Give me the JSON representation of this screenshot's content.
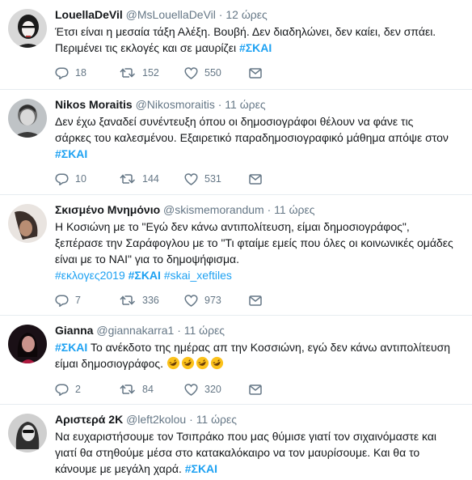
{
  "tweets": [
    {
      "name": "LouellaDeVil",
      "handle": "@MsLouellaDeVil",
      "sep": "·",
      "time": "12 ώρες",
      "line1": "Έτσι είναι η μεσαία τάξη Αλέξη. Βουβή. Δεν διαδηλώνει, δεν καίει, δεν σπάει.",
      "line2_text": "Περιμένει τις εκλογές και σε μαυρίζει ",
      "line2_tag": "#ΣΚΑΙ",
      "replies": "18",
      "retweets": "152",
      "likes": "550"
    },
    {
      "name": "Nikos Moraitis",
      "handle": "@Nikosmoraitis",
      "sep": "·",
      "time": "11 ώρες",
      "line1": "Δεν έχω ξαναδεί συνέντευξη όπου οι δημοσιογράφοι θέλουν να φάνε τις",
      "line2": "σάρκες του καλεσμένου. Εξαιρετικό παραδημοσιογραφικό μάθημα απόψε στον",
      "line3_tag": "#ΣΚΑΙ",
      "replies": "10",
      "retweets": "144",
      "likes": "531"
    },
    {
      "name": "Σκισμένο Μνημόνιο",
      "handle": "@skismemorandum",
      "sep": "·",
      "time": "11 ώρες",
      "line1": "Η Κοσιώνη με το \"Εγώ δεν κάνω αντιπολίτευση, είμαι δημοσιογράφος\",",
      "line2": "ξεπέρασε την Σαράφογλου με το \"Τι φταίμε εμείς που όλες οι κοινωνικές ομάδες",
      "line3": "είναι με το ΝΑΙ\" για το δημοψήφισμα.",
      "tag1": "#εκλογες2019",
      "tag2": "#ΣΚΑΙ",
      "tag3": "#skai_xeftiles",
      "replies": "7",
      "retweets": "336",
      "likes": "973"
    },
    {
      "name": "Gianna",
      "handle": "@giannakarra1",
      "sep": "·",
      "time": "11 ώρες",
      "line1_tag": "#ΣΚΑΙ",
      "line1_text": " Το ανέκδοτο της ημέρας απ την Κοσσιώνη, εγώ δεν κάνω αντιπολίτευση",
      "line2_text": "είμαι δημοσιογράφος. ",
      "emoji": "🤣🤣🤣🤣",
      "replies": "2",
      "retweets": "84",
      "likes": "320"
    },
    {
      "name": "Αριστερά 2Κ",
      "handle": "@left2kolou",
      "sep": "·",
      "time": "11 ώρες",
      "line1": "Να ευχαριστήσουμε τον Τσιπράκο που μας θύμισε γιατί τον σιχαινόμαστε και",
      "line2": "γιατί θα στηθούμε μέσα στο κατακαλόκαιρο να τον μαυρίσουμε. Και θα το",
      "line3_text": "κάνουμε με μεγάλη χαρά. ",
      "line3_tag": "#ΣΚΑΙ"
    }
  ],
  "colors": {
    "link": "#1da1f2",
    "muted": "#657786",
    "text": "#14171a",
    "divider": "#e6ecf0"
  },
  "icons": [
    "reply-icon",
    "retweet-icon",
    "like-icon",
    "message-icon"
  ]
}
